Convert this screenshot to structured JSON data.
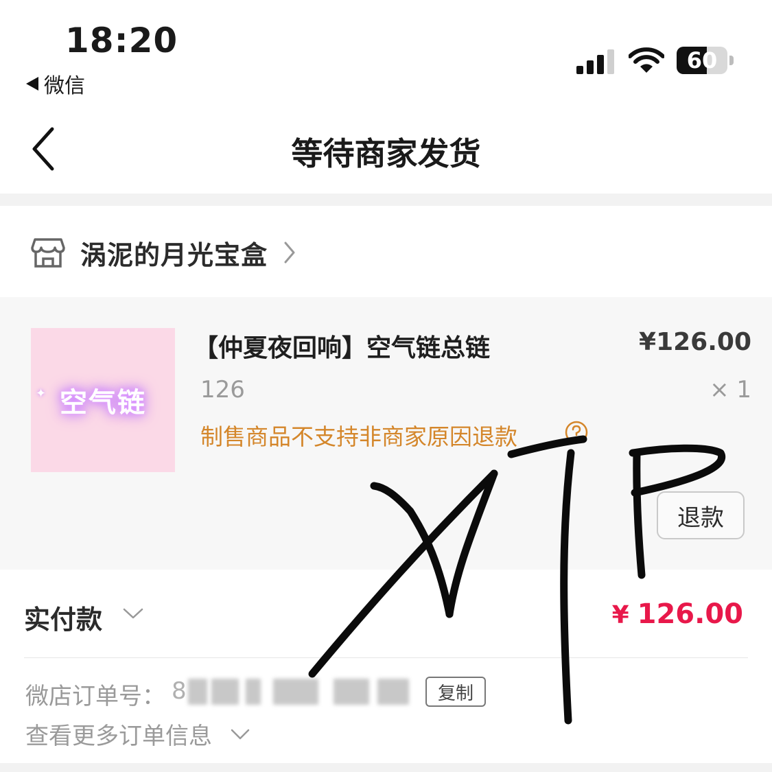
{
  "status_bar": {
    "time": "18:20",
    "back_app": "微信",
    "battery": "60",
    "battery_fraction": 0.6
  },
  "nav": {
    "title": "等待商家发货"
  },
  "store": {
    "name": "涡泥的月光宝盒"
  },
  "product": {
    "thumbnail_text": "空气链",
    "title": "【仲夏夜回响】空气链总链",
    "price": "¥126.00",
    "spec": "126",
    "quantity": "× 1",
    "refund_note": "制售商品不支持非商家原因退款",
    "refund_button": "退款"
  },
  "payment": {
    "label": "实付款",
    "currency": "¥",
    "amount": "126.00"
  },
  "order": {
    "label": "微店订单号：",
    "number_visible_fragment": "8",
    "copy_button": "复制",
    "more_info": "查看更多订单信息"
  },
  "colors": {
    "accent_red": "#e8184a",
    "warning_orange": "#d4862a",
    "thumb_pink": "#fbd9e7"
  }
}
